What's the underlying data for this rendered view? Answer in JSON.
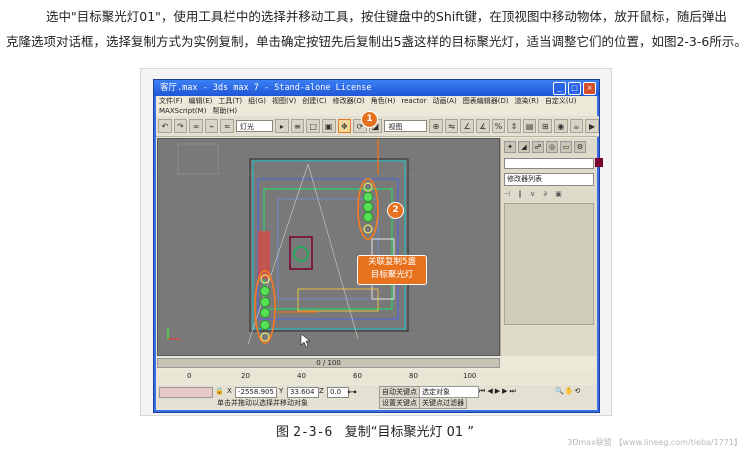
{
  "intro": {
    "line1": "选中\"目标聚光灯01\"，使用工具栏中的选择并移动工具，按住键盘中的Shift键，在顶视图中移动物体，放开鼠标，随后弹出",
    "line2": "克隆选项对话框，选择复制方式为实例复制，单击确定按钮先后复制出5盏这样的目标聚光灯，适当调整它们的位置，如图2-3-6所示。"
  },
  "app": {
    "title": "客厅.max - 3ds max 7  - Stand-alone License",
    "window_buttons": [
      "_",
      "□",
      "×"
    ],
    "menu": [
      "文件(F)",
      "编辑(E)",
      "工具(T)",
      "组(G)",
      "视图(V)",
      "创建(C)",
      "修改器(O)",
      "角色(H)",
      "reactor",
      "动画(A)",
      "图表编辑器(D)",
      "渲染(R)",
      "自定义(U)"
    ],
    "menu2": [
      "MAXScript(M)",
      "帮助(H)"
    ],
    "toolbar": {
      "selection_filter": "灯光",
      "view_dropdown": "视图"
    },
    "command_panel": {
      "modifier_list": "修改器列表"
    },
    "timeline": "0 / 100",
    "ruler_ticks": [
      "0",
      "20",
      "40",
      "60",
      "80",
      "100"
    ],
    "status": {
      "x_label": "X",
      "x_value": "-2558.905",
      "y_label": "Y",
      "y_value": "33.604",
      "z_label": "Z",
      "z_value": "0.0",
      "auto_key": "自动关键点",
      "set_key": "设置关键点",
      "key_filter": "关键点过滤器",
      "selection_dropdown": "选定对象",
      "hint": "单击并拖动以选择并移动对象"
    }
  },
  "annotations": {
    "badge1": "1",
    "badge2": "2",
    "callout_line1": "关联复制5盏",
    "callout_line2": "目标聚光灯"
  },
  "caption": {
    "prefix": "图",
    "number": "2-3-6",
    "text": "复制“目标聚光灯 01 ”"
  },
  "watermark": "3Dmax联盟 【www.lineeg.com/tieba/1771】",
  "colors": {
    "accent_orange": "#e8711d",
    "xp_blue": "#3a6ee8",
    "viewport_grey": "#797979"
  }
}
